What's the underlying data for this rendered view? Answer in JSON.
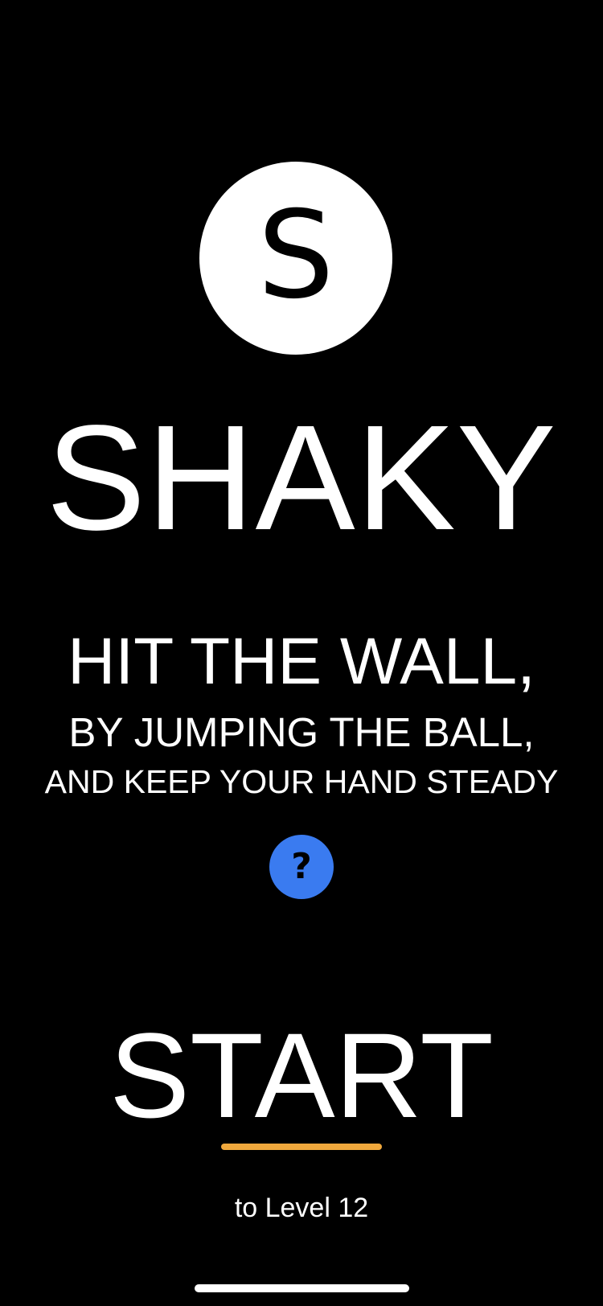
{
  "logo": {
    "letter": "S"
  },
  "title": "SHAKY",
  "tagline": {
    "line1": "HIT THE WALL,",
    "line2": "BY JUMPING THE BALL,",
    "line3": "AND KEEP YOUR HAND STEADY"
  },
  "help": {
    "glyph": "?",
    "icon": "question-mark-icon"
  },
  "start": {
    "label": "START"
  },
  "level": {
    "text": "to Level 12"
  },
  "colors": {
    "background": "#000000",
    "foreground": "#ffffff",
    "help_button": "#3a7bf0",
    "start_underline": "#f0a83c"
  }
}
